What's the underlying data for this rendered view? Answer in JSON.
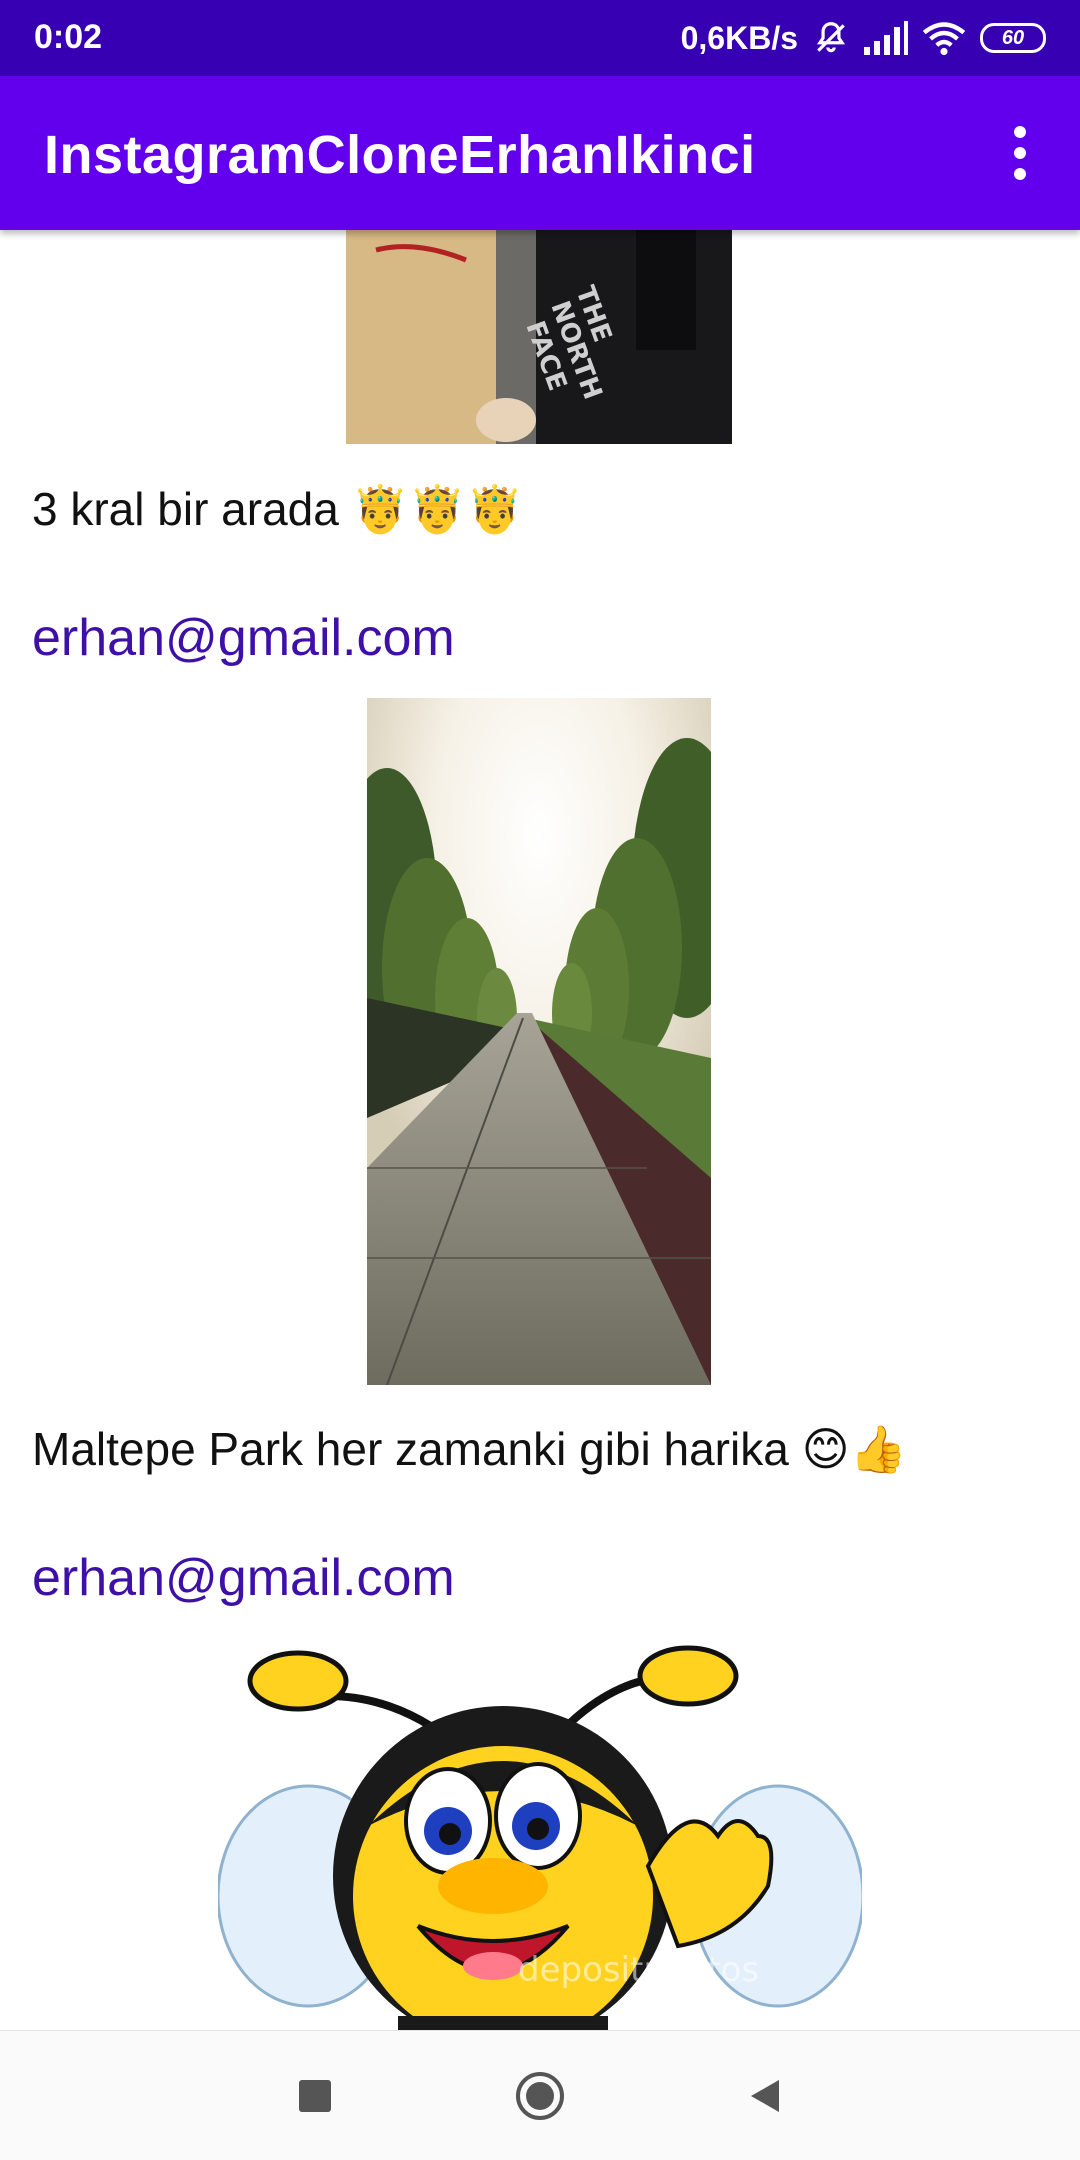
{
  "status_bar": {
    "time": "0:02",
    "network_speed": "0,6KB/s",
    "battery_level": "60",
    "icons": [
      "mute-bell-icon",
      "signal-icon",
      "wifi-icon",
      "battery-icon"
    ]
  },
  "app_bar": {
    "title": "InstagramCloneErhanIkinci",
    "menu_icon": "overflow-menu-icon"
  },
  "feed": {
    "posts": [
      {
        "image": "photo-people-north-face",
        "caption": "3 kral bir arada 🤴🤴🤴"
      },
      {
        "email": "erhan@gmail.com",
        "image": "photo-park-path",
        "caption": "Maltepe Park her zamanki gibi harika 😊👍"
      },
      {
        "email": "erhan@gmail.com",
        "image": "cartoon-bee",
        "watermark": "depositphotos"
      }
    ]
  },
  "nav_bar": {
    "items": [
      "recents-button",
      "home-button",
      "back-button"
    ]
  },
  "colors": {
    "status_bar": "#3700b3",
    "app_bar": "#6200ee",
    "email_text": "#3f10a8"
  }
}
